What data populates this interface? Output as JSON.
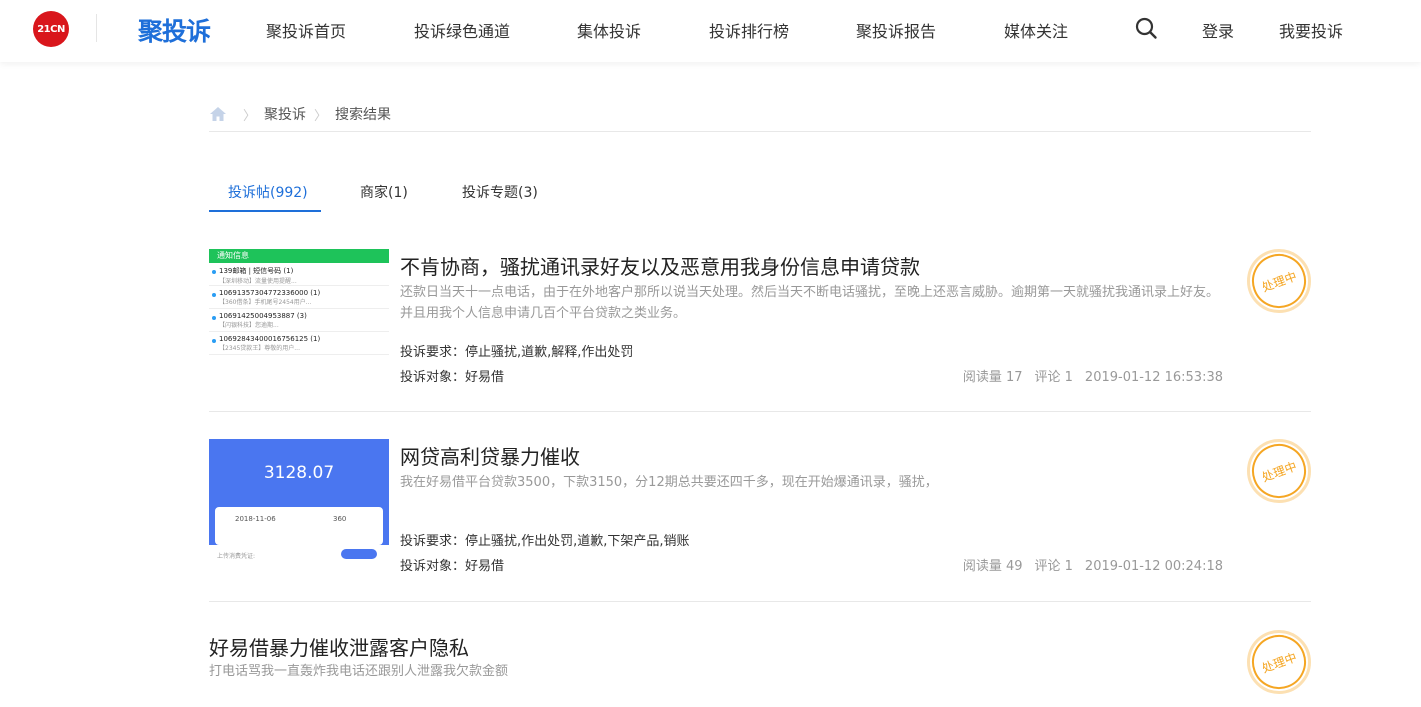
{
  "header": {
    "logo_21cn": "21CN",
    "brand": "聚投诉",
    "nav": [
      "聚投诉首页",
      "投诉绿色通道",
      "集体投诉",
      "投诉排行榜",
      "聚投诉报告",
      "媒体关注"
    ],
    "login": "登录",
    "complain": "我要投诉"
  },
  "breadcrumb": {
    "home": "聚投诉",
    "current": "搜索结果"
  },
  "tabs": [
    {
      "label": "投诉帖(992)",
      "active": true
    },
    {
      "label": "商家(1)",
      "active": false
    },
    {
      "label": "投诉专题(3)",
      "active": false
    }
  ],
  "results": [
    {
      "title": "不肯协商，骚扰通讯录好友以及恶意用我身份信息申请贷款",
      "desc": "还款日当天十一点电话，由于在外地客户那所以说当天处理。然后当天不断电话骚扰，至晚上还恶言威胁。逾期第一天就骚扰我通讯录上好友。并且用我个人信息申请几百个平台贷款之类业务。",
      "demand_label": "投诉要求：",
      "demand": "停止骚扰,道歉,解释,作出处罚",
      "target_label": "投诉对象：",
      "target": "好易借",
      "reads": "阅读量 17",
      "comments": "评论 1",
      "time": "2019-01-12 16:53:38",
      "status": "处理中",
      "thumb": {
        "bar": "通知信息",
        "rows": [
          {
            "t": "139邮箱 | 短信号码 (1)",
            "s": "【深圳移动】流量使用提醒..."
          },
          {
            "t": "10691357304772336000 (1)",
            "s": "【360借条】手机尾号2454用户..."
          },
          {
            "t": "10691425004953887 (3)",
            "s": "【闪银科技】您逾期..."
          },
          {
            "t": "10692843400016756125 (1)",
            "s": "【2345贷款王】尊敬的用户..."
          }
        ]
      }
    },
    {
      "title": "网贷高利贷暴力催收",
      "desc": "我在好易借平台贷款3500，下款3150，分12期总共要还四千多，现在开始爆通讯录，骚扰，",
      "demand_label": "投诉要求：",
      "demand": "停止骚扰,作出处罚,道歉,下架产品,销账",
      "target_label": "投诉对象：",
      "target": "好易借",
      "reads": "阅读量 49",
      "comments": "评论 1",
      "time": "2019-01-12 00:24:18",
      "status": "处理中",
      "thumb": {
        "amount": "3128.07",
        "date": "2018-11-06",
        "days": "360",
        "upload": "上传消费凭证:"
      }
    },
    {
      "title": "好易借暴力催收泄露客户隐私",
      "desc": "打电话骂我一直轰炸我电话还跟别人泄露我欠款金额",
      "status": "处理中"
    }
  ]
}
